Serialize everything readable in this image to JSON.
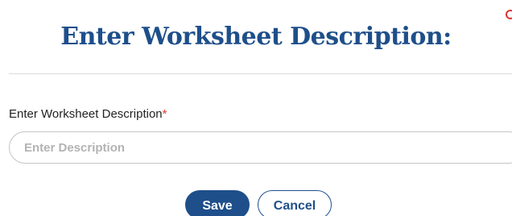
{
  "dialog": {
    "title": "Enter Worksheet Description:",
    "field": {
      "label": "Enter Worksheet Description",
      "required_marker": "*",
      "value": "",
      "placeholder": "Enter Description"
    },
    "buttons": {
      "save_label": "Save",
      "cancel_label": "Cancel"
    },
    "colors": {
      "primary": "#1e4f8a",
      "required": "#e0342f",
      "close_icon": "#e0342f"
    },
    "icons": {
      "close": "close-icon"
    }
  }
}
